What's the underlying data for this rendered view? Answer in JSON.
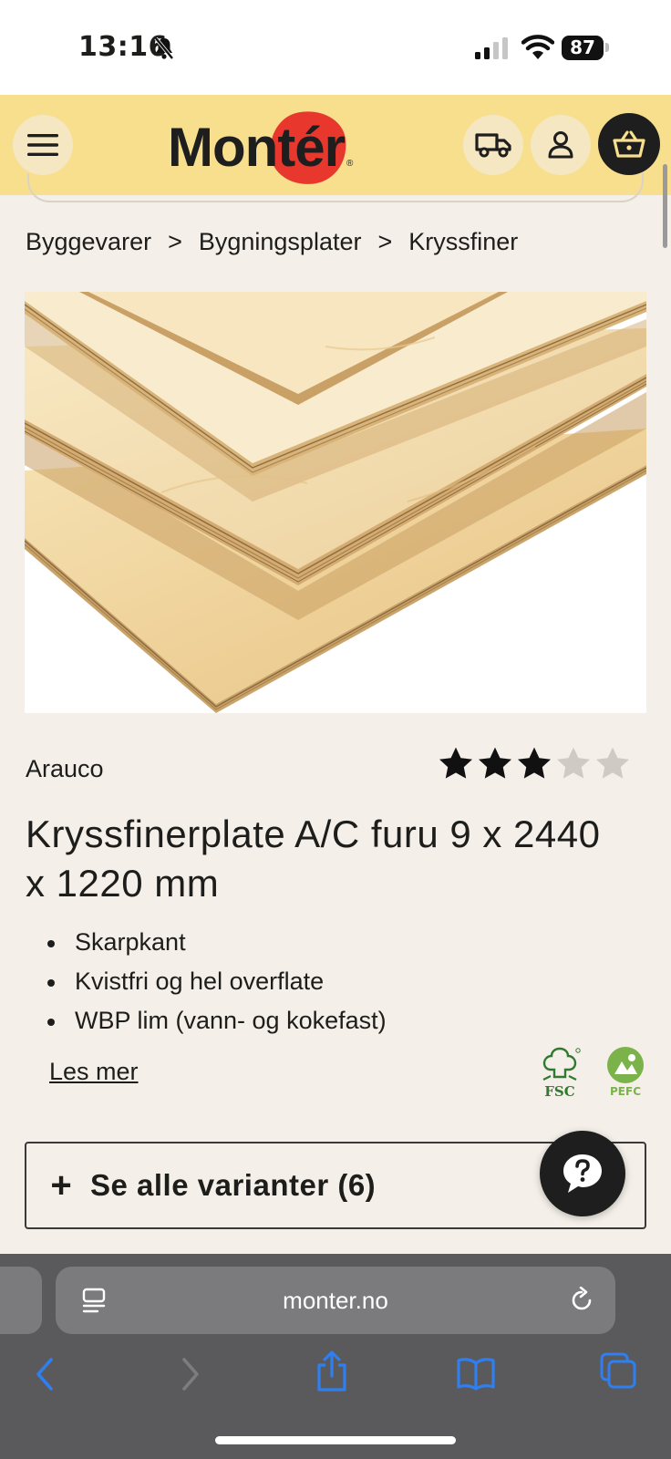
{
  "status_bar": {
    "time": "13:16",
    "battery": "87"
  },
  "header": {
    "logo_text": "Montér",
    "logo_registered": "®"
  },
  "breadcrumb": {
    "items": [
      "Byggevarer",
      "Bygningsplater",
      "Kryssfiner"
    ],
    "separator": ">"
  },
  "product": {
    "brand": "Arauco",
    "rating": 3,
    "rating_max": 5,
    "title": "Kryssfinerplate A/C furu 9 x 2440 x 1220 mm",
    "features": [
      "Skarpkant",
      "Kvistfri og hel overflate",
      "WBP lim (vann- og kokefast)"
    ],
    "read_more": "Les mer",
    "certifications": [
      "FSC",
      "PEFC"
    ]
  },
  "variants_button": {
    "plus": "+",
    "label": "Se alle varianter (6)"
  },
  "browser": {
    "url": "monter.no"
  },
  "colors": {
    "header_bg": "#f7df8e",
    "page_bg": "#f4efe8",
    "logo_accent": "#e8382e",
    "cert_green": "#2f7a2f",
    "dark": "#1e1e1e",
    "ios_blue": "#2f7ff0"
  }
}
